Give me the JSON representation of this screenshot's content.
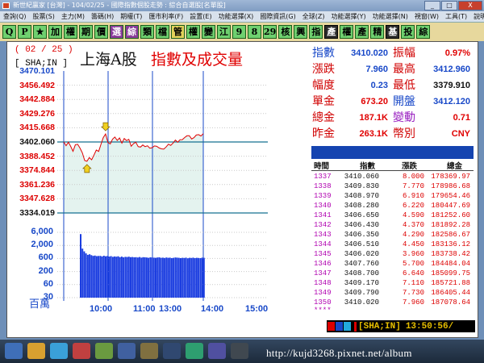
{
  "window": {
    "title": "新世紀贏家 [台灣] - 104/02/25 - 國際指數個股走勢 : 綜合自選股[名單股]",
    "controls": [
      "_",
      "□",
      "X"
    ]
  },
  "menu": [
    "查詢(Q)",
    "股票(S)",
    "主力(M)",
    "籌碼(H)",
    "期權(T)",
    "匯市利率(F)",
    "設置(E)",
    "功能選擇(X)",
    "國際資訊(G)",
    "全球(Z)",
    "功能選擇(Y)",
    "功能選擇(N)",
    "視窗(W)",
    "工具(T)",
    "說明(H)"
  ],
  "toolbar": [
    {
      "label": "Q",
      "style": "green"
    },
    {
      "label": "P",
      "style": "green"
    },
    {
      "label": "★",
      "style": "green"
    },
    {
      "label": "加",
      "style": "green"
    },
    {
      "label": "權",
      "style": "green"
    },
    {
      "label": "期",
      "style": "green"
    },
    {
      "label": "價",
      "style": "green"
    },
    {
      "label": "選",
      "style": "purple"
    },
    {
      "label": "綜",
      "style": "purple"
    },
    {
      "label": "類",
      "style": "green"
    },
    {
      "label": "檔",
      "style": "green"
    },
    {
      "label": "管",
      "style": "yellow"
    },
    {
      "label": "權",
      "style": "green"
    },
    {
      "label": "變",
      "style": "green"
    },
    {
      "label": "江",
      "style": "green"
    },
    {
      "label": "9",
      "style": "green"
    },
    {
      "label": "8",
      "style": "green"
    },
    {
      "label": "29",
      "style": "green"
    },
    {
      "label": "核",
      "style": "green"
    },
    {
      "label": "興",
      "style": "green"
    },
    {
      "label": "指",
      "style": "green"
    },
    {
      "label": "產",
      "style": "dark"
    },
    {
      "label": "權",
      "style": "green"
    },
    {
      "label": "產",
      "style": "green"
    },
    {
      "label": "精",
      "style": "green"
    },
    {
      "label": "基",
      "style": "dark"
    },
    {
      "label": "投",
      "style": "green"
    },
    {
      "label": "綜",
      "style": "green"
    }
  ],
  "chart_header": {
    "date": "( 02 / 25 )",
    "symbol": "[ SHA;IN ]",
    "title": "上海A股",
    "subtitle": "指數及成交量"
  },
  "chart_data": {
    "type": "line",
    "title": "上海A股 指數及成交量",
    "reference_price": 3402.06,
    "y_ticks": [
      "3470.101",
      "3456.492",
      "3442.884",
      "3429.276",
      "3415.668",
      "3402.060",
      "3388.452",
      "3374.844",
      "3361.236",
      "3347.628",
      "3334.019"
    ],
    "ylim": [
      3334.019,
      3470.101
    ],
    "x_ticks": [
      "10:00",
      "11:00",
      "13:00",
      "14:00",
      "15:00"
    ],
    "price_series": {
      "name": "指數",
      "x": [
        0,
        4,
        8,
        12,
        16,
        20,
        24,
        28,
        32,
        36,
        40,
        44,
        48,
        52,
        56,
        60,
        64,
        68,
        72,
        76,
        80,
        84,
        88,
        92,
        96,
        100,
        104,
        108,
        112,
        116,
        120,
        124,
        128,
        132,
        136,
        140,
        144,
        148,
        152,
        156,
        160,
        164,
        168,
        172,
        176,
        180,
        184,
        188,
        192,
        196,
        200,
        204,
        208,
        212,
        216,
        220,
        224,
        228,
        232,
        236,
        240
      ],
      "y": [
        3402.1,
        3398.5,
        3401.8,
        3397.9,
        3393.1,
        3399.4,
        3399.8,
        3396.2,
        3391.6,
        3384.3,
        3383.6,
        3387.1,
        3385.0,
        3389.5,
        3394.3,
        3393.0,
        3399.7,
        3406.2,
        3409.7,
        3401.5,
        3400.2,
        3404.8,
        3406.8,
        3403.5,
        3405.9,
        3400.9,
        3405.4,
        3403.4,
        3404.6,
        3398.0,
        3400.5,
        3401.8,
        3397.6,
        3397.2,
        3399.2,
        3397.6,
        3398.4,
        3396.1,
        3396.6,
        3398.3,
        3397.9,
        3396.3,
        3395.5,
        3395.2,
        3397.3,
        3400.0,
        3398.8,
        3401.0,
        3403.9,
        3401.8,
        3404.2,
        3404.3,
        3406.3,
        3408.0,
        3408.1,
        3404.9,
        3406.2,
        3408.7,
        3409.1,
        3407.8,
        3410.0
      ]
    },
    "markers": [
      {
        "label": "high",
        "x": 72,
        "y": 3409.7
      },
      {
        "label": "low",
        "x": 40,
        "y": 3383.6
      }
    ],
    "volume_ticks": [
      "6,000",
      "2,000",
      "600",
      "200",
      "60",
      "30"
    ],
    "volume_unit": "百萬",
    "volume_scale": "log",
    "volume_series": {
      "name": "成交量",
      "values": [
        5200,
        1600,
        1280,
        1090,
        970,
        1010,
        940,
        890,
        910,
        870,
        880,
        890,
        850,
        900,
        860,
        880,
        840,
        870,
        820,
        850,
        830,
        860,
        800,
        840,
        790,
        820,
        810,
        830,
        800,
        810,
        790,
        800,
        780,
        810,
        770,
        800,
        790,
        780,
        760,
        790,
        780,
        770,
        760,
        780,
        790,
        760,
        770,
        750,
        780,
        760,
        770,
        740,
        760,
        780,
        770,
        760,
        740,
        760,
        750,
        770,
        730,
        760,
        750,
        770,
        740,
        760,
        750,
        740,
        770,
        760
      ]
    }
  },
  "info_panel": [
    {
      "label": "指數",
      "label_color": "#1848c8",
      "value": "3410.020",
      "value_color": "#1848c8",
      "label2": "振幅",
      "label2_color": "#d00000",
      "value2": "0.97%",
      "value2_color": "#e00000"
    },
    {
      "label": "漲跌",
      "label_color": "#d00000",
      "value": "7.960",
      "value_color": "#1848c8",
      "label2": "最高",
      "label2_color": "#d00000",
      "value2": "3412.960",
      "value2_color": "#1848c8"
    },
    {
      "label": "幅度",
      "label_color": "#d00000",
      "value": "0.23",
      "value_color": "#1848c8",
      "label2": "最低",
      "label2_color": "#d00000",
      "value2": "3379.910",
      "value2_color": "#111111"
    },
    {
      "label": "單金",
      "label_color": "#d00000",
      "value": "673.20",
      "value_color": "#e00000",
      "label2": "開盤",
      "label2_color": "#1848c8",
      "value2": "3412.120",
      "value2_color": "#1848c8"
    },
    {
      "label": "總金",
      "label_color": "#d00000",
      "value": "187.1K",
      "value_color": "#e00000",
      "label2": "變動",
      "label2_color": "#9920c0",
      "value2": "0.71",
      "value2_color": "#e00000"
    },
    {
      "label": "昨金",
      "label_color": "#d00000",
      "value": "263.1K",
      "value_color": "#e00000",
      "label2": "幣別",
      "label2_color": "#d00000",
      "value2": "CNY",
      "value2_color": "#e00000"
    }
  ],
  "ticks_table": {
    "headers": [
      "時間",
      "指數",
      "漲跌",
      "總金"
    ],
    "rows": [
      [
        "1337",
        "3410.060",
        "8.000",
        "178369.97"
      ],
      [
        "1338",
        "3409.830",
        "7.770",
        "178986.68"
      ],
      [
        "1339",
        "3408.970",
        "6.910",
        "179654.46"
      ],
      [
        "1340",
        "3408.280",
        "6.220",
        "180447.69"
      ],
      [
        "1341",
        "3406.650",
        "4.590",
        "181252.60"
      ],
      [
        "1342",
        "3406.430",
        "4.370",
        "181892.28"
      ],
      [
        "1343",
        "3406.350",
        "4.290",
        "182586.67"
      ],
      [
        "1344",
        "3406.510",
        "4.450",
        "183136.12"
      ],
      [
        "1345",
        "3406.020",
        "3.960",
        "183738.42"
      ],
      [
        "1346",
        "3407.760",
        "5.700",
        "184484.04"
      ],
      [
        "1347",
        "3408.700",
        "6.640",
        "185099.75"
      ],
      [
        "1348",
        "3409.170",
        "7.110",
        "185721.88"
      ],
      [
        "1349",
        "3409.790",
        "7.730",
        "186405.44"
      ],
      [
        "1350",
        "3410.020",
        "7.960",
        "187078.64"
      ]
    ],
    "more": "****"
  },
  "status": {
    "symbol": "[SHA;IN]",
    "time": "13:50:56/"
  },
  "watermark_url": "http://kujd3268.pixnet.net/album"
}
